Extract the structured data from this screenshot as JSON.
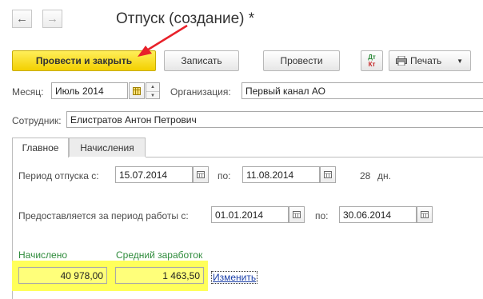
{
  "nav": {
    "back_icon": "arrow-left-icon",
    "forward_icon": "arrow-right-icon"
  },
  "window_title": "Отпуск (создание) *",
  "toolbar": {
    "post_and_close": "Провести и закрыть",
    "save": "Записать",
    "post": "Провести",
    "dt_kt_top": "Дт",
    "dt_kt_bottom": "Кт",
    "print": "Печать"
  },
  "form": {
    "month_label": "Месяц:",
    "month_value": "Июль 2014",
    "org_label": "Организация:",
    "org_value": "Первый канал АО",
    "employee_label": "Сотрудник:",
    "employee_value": "Елистратов Антон Петрович"
  },
  "tabs": [
    "Главное",
    "Начисления"
  ],
  "main": {
    "vacation_period_label": "Период отпуска с:",
    "vacation_from": "15.07.2014",
    "to_label": "по:",
    "vacation_to": "11.08.2014",
    "days_count": "28",
    "days_unit": "дн.",
    "work_period_label": "Предоставляется за период работы с:",
    "work_from": "01.01.2014",
    "work_to_label": "по:",
    "work_to": "30.06.2014",
    "accrued_label": "Начислено",
    "avg_earnings_label": "Средний заработок",
    "accrued_value": "40 978,00",
    "avg_earnings_value": "1 463,50",
    "change_link": "Изменить"
  },
  "colors": {
    "accent_yellow": "#f3d000",
    "highlight": "#ffff7a",
    "arrow": "#e8212a",
    "label_green": "#2e8b3b",
    "link": "#1b3fa8"
  }
}
